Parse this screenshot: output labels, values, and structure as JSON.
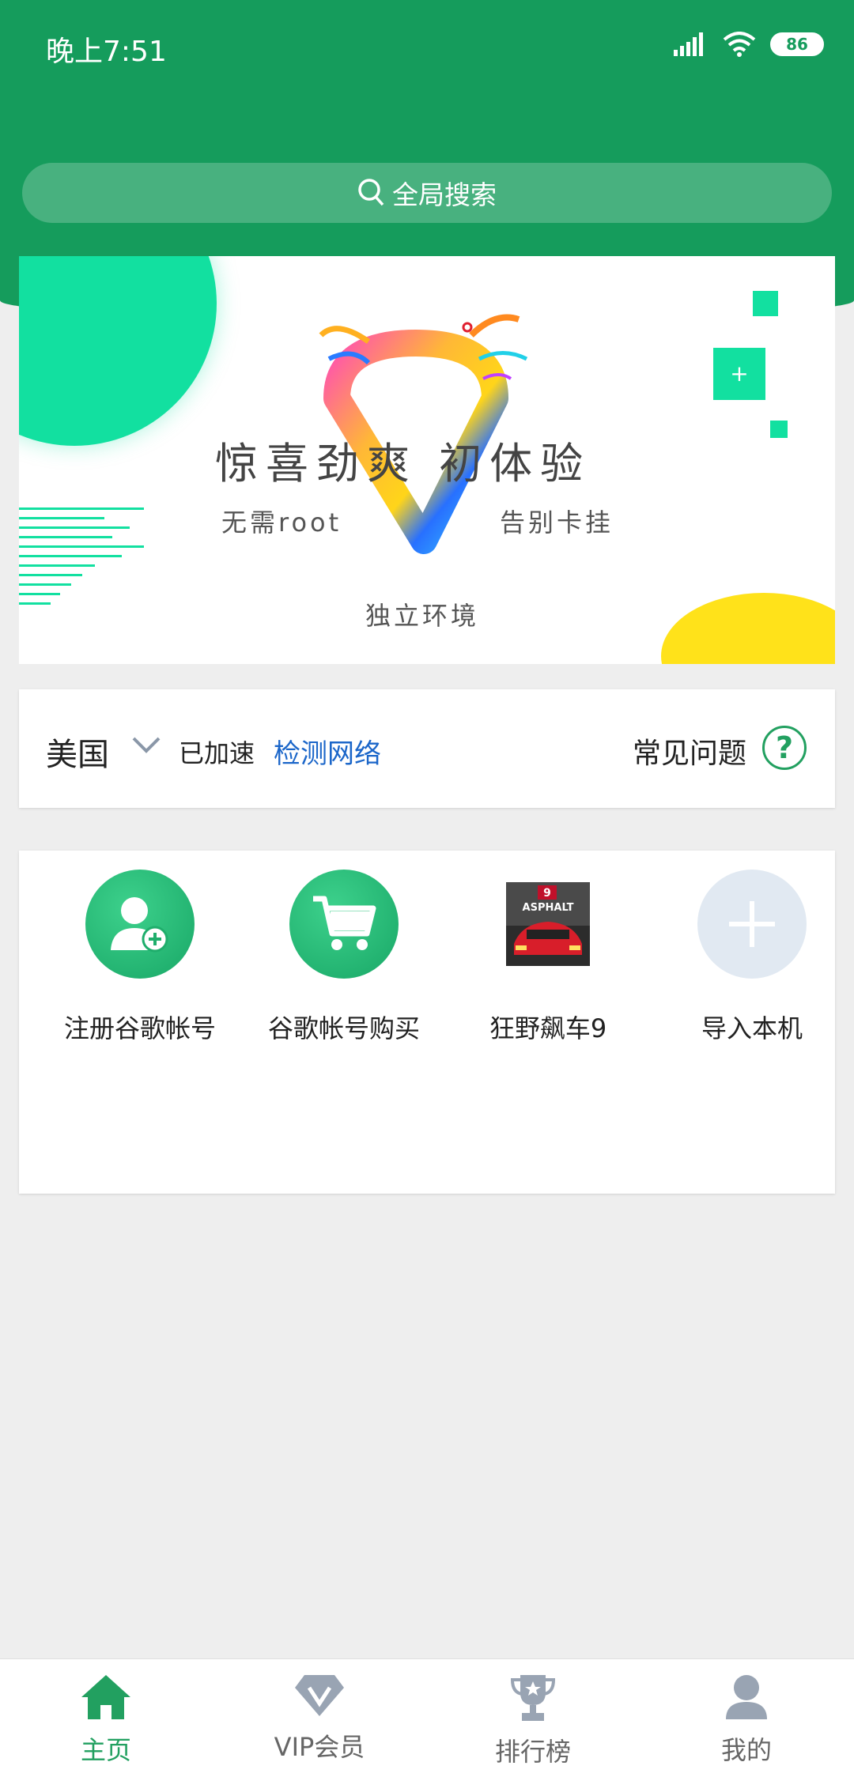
{
  "status_bar": {
    "time": "晚上7:51",
    "battery": "86"
  },
  "search": {
    "placeholder": "全局搜索"
  },
  "banner": {
    "title": "惊喜劲爽  初体验",
    "left_text": "无需root",
    "right_text": "告别卡挂",
    "bottom_text": "独立环境",
    "colors": {
      "accent": "#12e0a0",
      "yellow": "#ffe21a"
    }
  },
  "network": {
    "country": "美国",
    "status": "已加速",
    "detect_link": "检测网络",
    "faq": "常见问题",
    "faq_icon": "question-icon"
  },
  "apps": [
    {
      "label": "注册谷歌帐号",
      "icon": "add-user-icon"
    },
    {
      "label": "谷歌帐号购买",
      "icon": "cart-icon"
    },
    {
      "label": "狂野飙车9",
      "icon": "asphalt-game-icon",
      "game_badge": "9",
      "game_title": "ASPHALT"
    },
    {
      "label": "导入本机",
      "icon": "plus-icon"
    }
  ],
  "bottom_nav": [
    {
      "label": "主页",
      "icon": "home-icon",
      "active": true
    },
    {
      "label": "VIP会员",
      "icon": "vip-diamond-icon",
      "active": false
    },
    {
      "label": "排行榜",
      "icon": "trophy-icon",
      "active": false
    },
    {
      "label": "我的",
      "icon": "person-icon",
      "active": false
    }
  ],
  "colors": {
    "brand_green": "#159c5c",
    "active_green": "#22a060",
    "link_blue": "#1b66c9"
  }
}
